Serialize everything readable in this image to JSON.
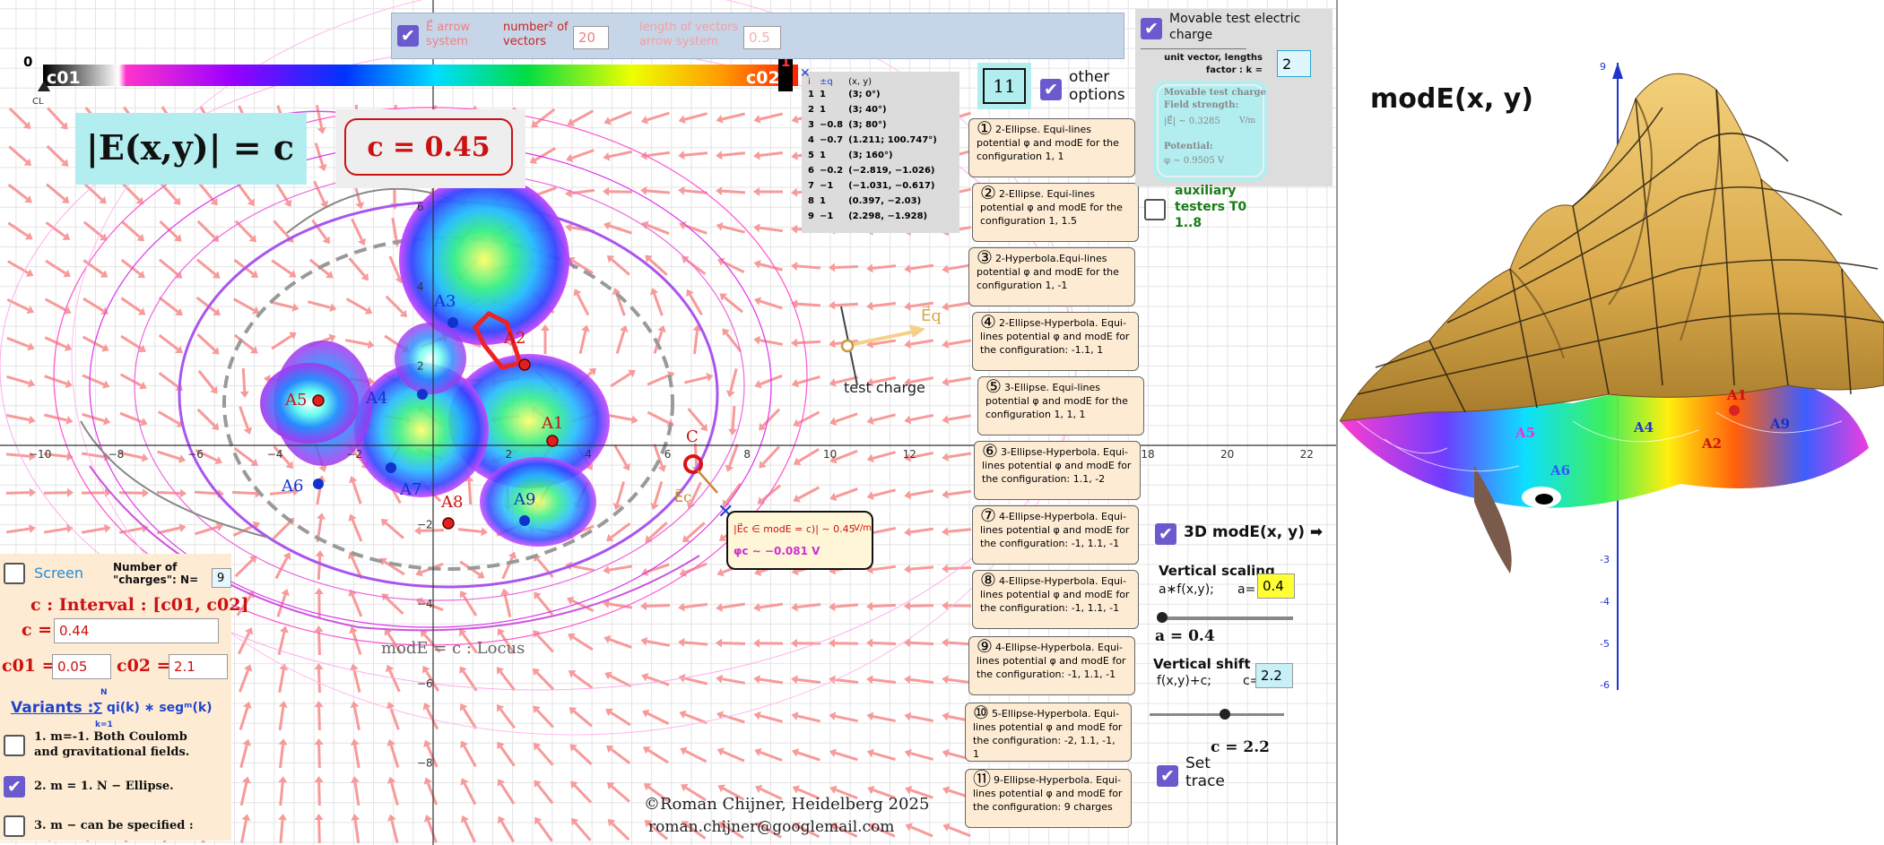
{
  "colorbar": {
    "left_value": "0",
    "c01_label": "c01",
    "c02_label": "c02",
    "cl_label": "CL",
    "right_value": "1"
  },
  "top_bar": {
    "arrow_system_label": "E⃗ arrow system",
    "num_vectors_label": "number² of vectors",
    "num_vectors_value": "20",
    "length_label": "length of vectors arrow system",
    "length_value": "0.5"
  },
  "formula": {
    "left": "|E(x,y)| = c",
    "c_value": "c = 0.45"
  },
  "x_ticks": [
    "−10",
    "−8",
    "−6",
    "−4",
    "−2",
    "0",
    "2",
    "4",
    "6",
    "8",
    "10",
    "12",
    "14",
    "16",
    "18",
    "20",
    "22"
  ],
  "y_ticks": [
    "6",
    "4",
    "2",
    "−2",
    "−4",
    "−6",
    "−8"
  ],
  "charges_table": {
    "headers": [
      "i",
      "±q",
      "(x, y)"
    ],
    "rows": [
      [
        "1",
        "1",
        "(3; 0°)"
      ],
      [
        "2",
        "1",
        "(3; 40°)"
      ],
      [
        "3",
        "−0.8",
        "(3; 80°)"
      ],
      [
        "4",
        "−0.7",
        "(1.211; 100.747°)"
      ],
      [
        "5",
        "1",
        "(3; 160°)"
      ],
      [
        "6",
        "−0.2",
        "(−2.819, −1.026)"
      ],
      [
        "7",
        "−1",
        "(−1.031, −0.617)"
      ],
      [
        "8",
        "1",
        "(0.397, −2.03)"
      ],
      [
        "9",
        "−1",
        "(2.298, −1.928)"
      ]
    ]
  },
  "count_box": "11",
  "other_options": "other options",
  "point_labels": [
    "A1",
    "A2",
    "A3",
    "A4",
    "A5",
    "A6",
    "A7",
    "A8",
    "A9",
    "C"
  ],
  "test_charge": {
    "label": "test charge",
    "eq": "E⃗q",
    "ec": "E⃗c"
  },
  "readout": {
    "line1": "|E⃗c ∈ modE = c)| ∼ 0.45",
    "unit1": "V/m",
    "line2": "φc ∼ −0.081 V"
  },
  "locus_label": "modE = c : Locus",
  "credit": {
    "line1": "©Roman Chijner, Heidelberg 2025",
    "line2": "roman.chijner@googlemail.com"
  },
  "left_panel": {
    "screen_label": "Screen",
    "num_charges_label": "Number of \"charges\": N=",
    "num_charges_value": "9",
    "interval_title": "c :  Interval : [c01, c02]",
    "c_label": "c =",
    "c_value": "0.44",
    "c01_label": "c01 =",
    "c01_value": "0.05",
    "c02_label": "c02 =",
    "c02_value": "2.1",
    "variants_label": "Variants :",
    "variants_formula": "∑ qi(k) ∗ segᵐ(k)",
    "sum_top": "N",
    "sum_bottom": "k=1",
    "variant1": "1. m=-1. Both Coulomb and gravitational fields.",
    "variant2": "2. m = 1. N − Ellipse.",
    "variant3": "3. m − can be specified :"
  },
  "cases": [
    {
      "num": "①",
      "text": "2-Ellipse. Equi-lines potential φ and modE for the configuration 1, 1"
    },
    {
      "num": "②",
      "text": "2-Ellipse. Equi-lines potential φ and modE for the configuration 1, 1.5"
    },
    {
      "num": "③",
      "text": "2-Hyperbola.Equi-lines potential φ and modE for the configuration 1, -1"
    },
    {
      "num": "④",
      "text": "2-Ellipse-Hyperbola. Equi-lines potential φ and modE for the configuration: -1.1, 1"
    },
    {
      "num": "⑤",
      "text": "3-Ellipse. Equi-lines potential φ and modE for the configuration 1, 1, 1"
    },
    {
      "num": "⑥",
      "text": "3-Ellipse-Hyperbola. Equi-lines potential φ and modE for the configuration: 1.1, -2"
    },
    {
      "num": "⑦",
      "text": "4-Ellipse-Hyperbola. Equi-lines potential φ and modE for the configuration: -1, 1.1, -1"
    },
    {
      "num": "⑧",
      "text": "4-Ellipse-Hyperbola. Equi-lines potential φ and modE for the configuration: -1, 1.1, -1"
    },
    {
      "num": "⑨",
      "text": "4-Ellipse-Hyperbola. Equi-lines potential φ and modE for the configuration: -1, 1.1, -1"
    },
    {
      "num": "⑩",
      "text": "5-Ellipse-Hyperbola. Equi-lines potential φ and modE for the configuration: -2, 1.1, -1, 1"
    },
    {
      "num": "⑪",
      "text": "9-Ellipse-Hyperbola. Equi-lines potential φ and modE for the configuration: 9 charges"
    }
  ],
  "right_panel": {
    "movable_label": "Movable test electric charge",
    "unit_vector_label": "unit vector, lengths factor : k =",
    "k_value": "2",
    "card_title": "Movable test charge",
    "field_strength_label": "Field strength:",
    "field_strength_value": "|E⃗| ∼ 0.3285",
    "field_unit": "V/m",
    "potential_label": "Potential:",
    "potential_value": "φ ∼ 0.9505 V",
    "auxiliary_label": "auxiliary testers T0 1..8",
    "mode3d_label": "3D modE(x, y) ➡",
    "vscale_label": "Vertical scaling",
    "vscale_formula": "a∗f(x,y);",
    "a_label": "a=",
    "a_value": "0.4",
    "a_readout": "a = 0.4",
    "vshift_label": "Vertical shift",
    "vshift_formula": "f(x,y)+c;",
    "cshift_label": "c=",
    "cshift_value": "2.2",
    "c_readout": "c = 2.2",
    "set_trace": "Set trace"
  },
  "view3d": {
    "title": "modE(x, y)",
    "z_ticks": [
      "9",
      "-3",
      "-4",
      "-5",
      "-6"
    ],
    "labels": [
      "A1",
      "A9",
      "A2",
      "A5",
      "A6",
      "A4"
    ]
  }
}
